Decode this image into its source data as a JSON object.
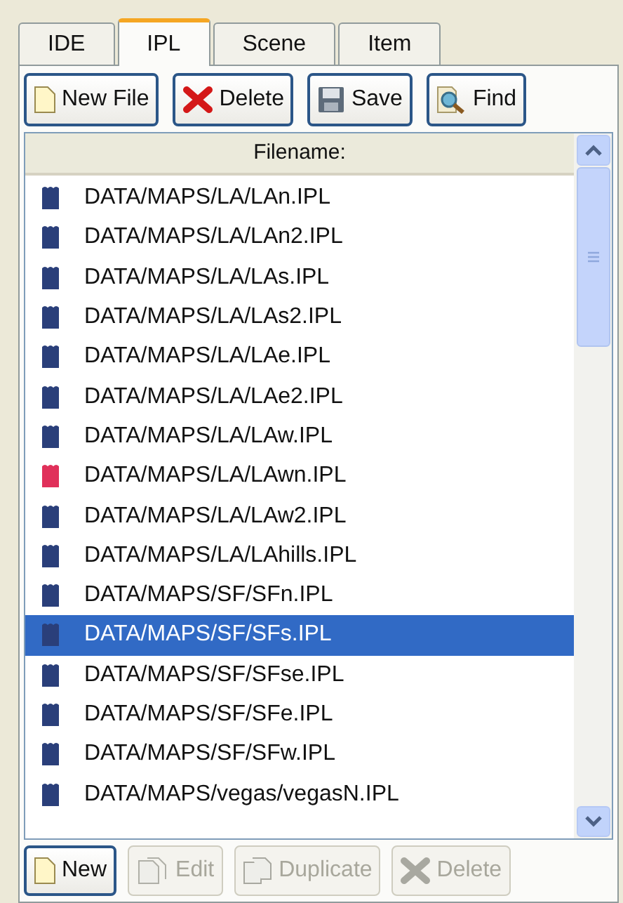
{
  "tabs": [
    {
      "label": "IDE",
      "selected": false
    },
    {
      "label": "IPL",
      "selected": true
    },
    {
      "label": "Scene",
      "selected": false
    },
    {
      "label": "Item",
      "selected": false
    }
  ],
  "toolbar": [
    {
      "label": "New File",
      "kind": "new"
    },
    {
      "label": "Delete",
      "kind": "delete"
    },
    {
      "label": "Save",
      "kind": "save"
    },
    {
      "label": "Find",
      "kind": "find"
    }
  ],
  "file_list": {
    "column": "Filename:",
    "rows": [
      {
        "name": "DATA/MAPS/LA/LAn.IPL",
        "color": "#2a3f7a",
        "selected": false
      },
      {
        "name": "DATA/MAPS/LA/LAn2.IPL",
        "color": "#2a3f7a",
        "selected": false
      },
      {
        "name": "DATA/MAPS/LA/LAs.IPL",
        "color": "#2a3f7a",
        "selected": false
      },
      {
        "name": "DATA/MAPS/LA/LAs2.IPL",
        "color": "#2a3f7a",
        "selected": false
      },
      {
        "name": "DATA/MAPS/LA/LAe.IPL",
        "color": "#2a3f7a",
        "selected": false
      },
      {
        "name": "DATA/MAPS/LA/LAe2.IPL",
        "color": "#2a3f7a",
        "selected": false
      },
      {
        "name": "DATA/MAPS/LA/LAw.IPL",
        "color": "#2a3f7a",
        "selected": false
      },
      {
        "name": "DATA/MAPS/LA/LAwn.IPL",
        "color": "#e0305a",
        "selected": false
      },
      {
        "name": "DATA/MAPS/LA/LAw2.IPL",
        "color": "#2a3f7a",
        "selected": false
      },
      {
        "name": "DATA/MAPS/LA/LAhills.IPL",
        "color": "#2a3f7a",
        "selected": false
      },
      {
        "name": "DATA/MAPS/SF/SFn.IPL",
        "color": "#2a3f7a",
        "selected": false
      },
      {
        "name": "DATA/MAPS/SF/SFs.IPL",
        "color": "#2a3f7a",
        "selected": true
      },
      {
        "name": "DATA/MAPS/SF/SFse.IPL",
        "color": "#2a3f7a",
        "selected": false
      },
      {
        "name": "DATA/MAPS/SF/SFe.IPL",
        "color": "#2a3f7a",
        "selected": false
      },
      {
        "name": "DATA/MAPS/SF/SFw.IPL",
        "color": "#2a3f7a",
        "selected": false
      },
      {
        "name": "DATA/MAPS/vegas/vegasN.IPL",
        "color": "#2a3f7a",
        "selected": false
      }
    ]
  },
  "actions": [
    {
      "label": "New",
      "kind": "new",
      "disabled": false
    },
    {
      "label": "Edit",
      "kind": "edit",
      "disabled": true
    },
    {
      "label": "Duplicate",
      "kind": "duplicate",
      "disabled": true
    },
    {
      "label": "Delete",
      "kind": "delete",
      "disabled": true
    }
  ]
}
